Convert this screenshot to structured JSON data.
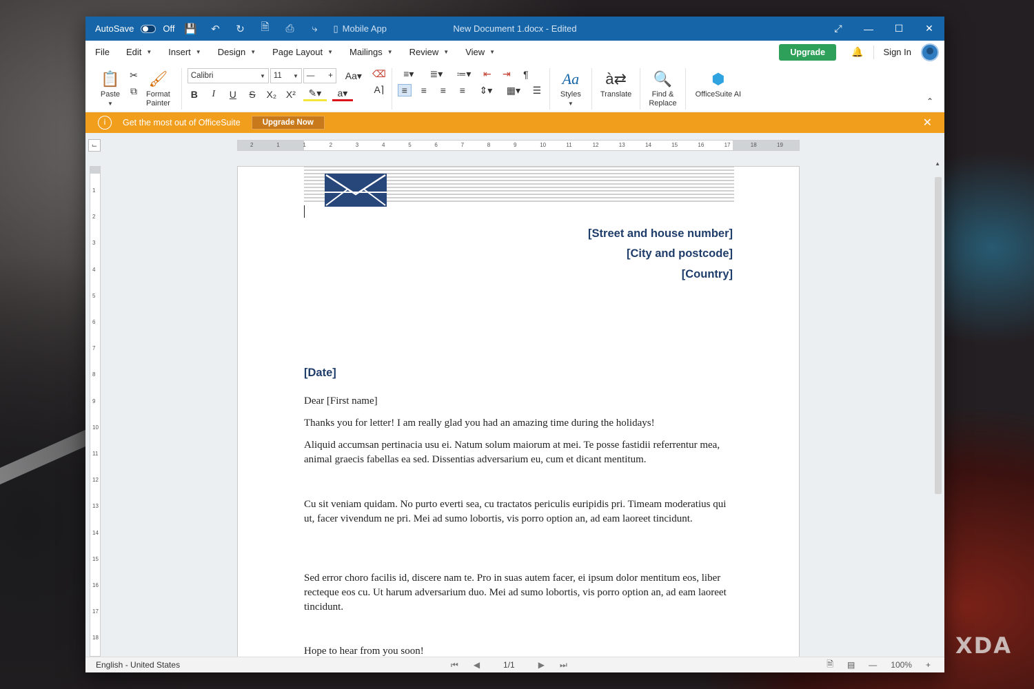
{
  "titlebar": {
    "autosave_label": "AutoSave",
    "autosave_state": "Off",
    "mobile_app": "Mobile App",
    "document_title": "New Document 1.docx - Edited"
  },
  "menu": {
    "items": [
      "File",
      "Edit",
      "Insert",
      "Design",
      "Page Layout",
      "Mailings",
      "Review",
      "View"
    ],
    "upgrade": "Upgrade",
    "sign_in": "Sign In"
  },
  "ribbon": {
    "paste": "Paste",
    "format_painter_1": "Format",
    "format_painter_2": "Painter",
    "font_name": "Calibri",
    "font_size": "11",
    "styles": "Styles",
    "translate": "Translate",
    "find_replace_1": "Find &",
    "find_replace_2": "Replace",
    "officesuite_ai": "OfficeSuite AI"
  },
  "notification": {
    "text": "Get the most out of OfficeSuite",
    "button": "Upgrade Now"
  },
  "document": {
    "street": "[Street and house number]",
    "city": "[City and postcode]",
    "country": "[Country]",
    "date": "[Date]",
    "greeting": "Dear [First name]",
    "line1": "Thanks you for letter! I am really glad you had an amazing time during the holidays!",
    "para1": "Aliquid accumsan pertinacia usu ei. Natum solum maiorum at mei. Te posse fastidii referrentur mea, animal graecis fabellas ea sed. Dissentias adversarium eu, cum et dicant mentitum.",
    "para2": "Cu sit veniam quidam. No purto everti sea, cu tractatos periculis euripidis pri. Timeam moderatius qui ut, facer vivendum ne pri. Mei ad sumo lobortis, vis porro option an, ad eam laoreet tincidunt.",
    "para3": "Sed error choro facilis id, discere nam te. Pro in suas autem facer, ei ipsum dolor mentitum eos, liber recteque eos cu. Ut harum adversarium duo. Mei ad sumo lobortis, vis porro option an, ad eam laoreet tincidunt.",
    "closing": "Hope to hear from you soon!"
  },
  "ruler": {
    "h_numbers": [
      "2",
      "1",
      "1",
      "2",
      "3",
      "4",
      "5",
      "6",
      "7",
      "8",
      "9",
      "10",
      "11",
      "12",
      "13",
      "14",
      "15",
      "16",
      "17",
      "18",
      "19"
    ],
    "v_numbers": [
      "1",
      "2",
      "3",
      "4",
      "5",
      "6",
      "7",
      "8",
      "9",
      "10",
      "11",
      "12",
      "13",
      "14",
      "15",
      "16",
      "17",
      "18"
    ]
  },
  "statusbar": {
    "language": "English - United States",
    "page": "1/1",
    "zoom": "100%"
  },
  "watermark": "XDA",
  "colors": {
    "titlebar": "#1565a8",
    "upgrade": "#2ea05a",
    "notification": "#f09e1c",
    "heading_blue": "#1f3d6a"
  }
}
